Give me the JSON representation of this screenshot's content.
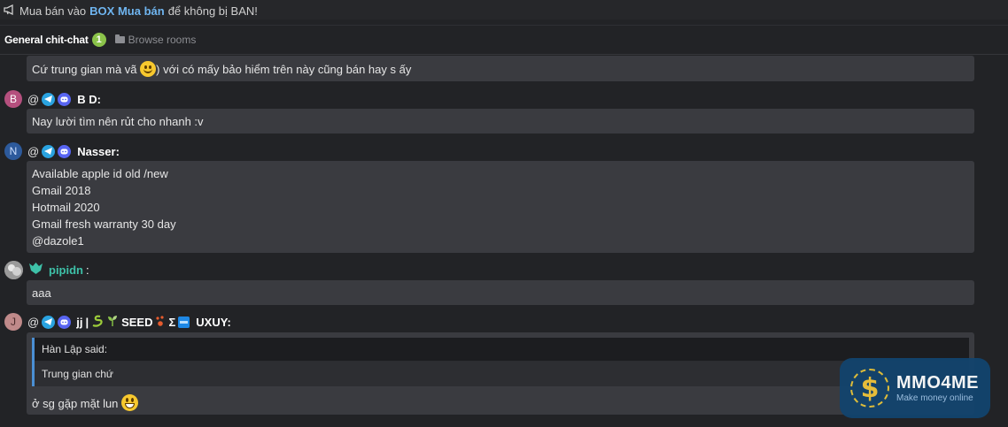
{
  "notice": {
    "icon": "megaphone-icon",
    "prefix": "Mua bán vào",
    "highlight": "BOX Mua bán",
    "suffix": "để không bị BAN!"
  },
  "tabs": {
    "active_label": "General chit-chat",
    "badge": "1",
    "browse_label": "Browse rooms"
  },
  "messages": [
    {
      "text_before": "Cứ trung gian mà vã",
      "text_after": ") với có mấy bảo hiểm trên này cũng bán hay s ấy"
    },
    {
      "avatar_letter": "B",
      "avatar_color": "#b5507e",
      "at": "@",
      "name": "B D:",
      "lines": [
        "Nay lười tìm nên rủt cho nhanh :v"
      ]
    },
    {
      "avatar_letter": "N",
      "avatar_color": "#2d5a9c",
      "at": "@",
      "name": "Nasser:",
      "lines": [
        "Available apple id old /new",
        "Gmail 2018",
        "Hotmail 2020",
        "Gmail fresh warranty 30 day",
        "@dazole1"
      ]
    },
    {
      "name": "pipidn",
      "name_color": "#3ec1a8",
      "colon": ":",
      "lines": [
        "aaa"
      ]
    },
    {
      "avatar_letter": "J",
      "avatar_color": "#c08a8a",
      "at": "@",
      "name_parts": [
        "jj",
        "|",
        "SEED",
        "Σ",
        "UXUY:"
      ],
      "quote_author": "Hàn Lập said:",
      "quote_text": "Trung gian chứ",
      "text": "ở sg gặp mặt lun"
    }
  ],
  "watermark": {
    "title": "MMO4ME",
    "subtitle": "Make money online"
  }
}
